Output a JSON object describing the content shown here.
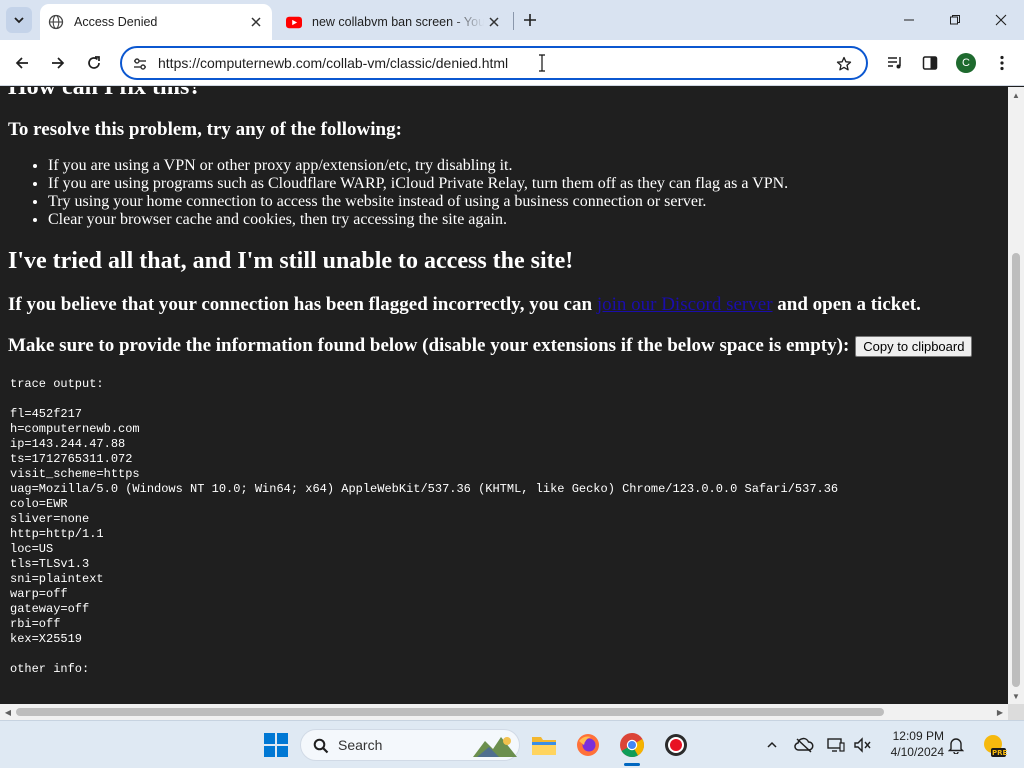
{
  "browser": {
    "tabs": [
      {
        "title": "Access Denied",
        "active": true
      },
      {
        "title": "new collabvm ban screen - You",
        "active": false
      }
    ],
    "url": "https://computernewb.com/collab-vm/classic/denied.html",
    "profile_initial": "C"
  },
  "page": {
    "heading_fix": "How can I fix this?",
    "heading_resolve": "To resolve this problem, try any of the following:",
    "fixes": [
      "If you are using a VPN or other proxy app/extension/etc, try disabling it.",
      "If you are using programs such as Cloudflare WARP, iCloud Private Relay, turn them off as they can flag as a VPN.",
      "Try using your home connection to access the website instead of using a business connection or server.",
      "Clear your browser cache and cookies, then try accessing the site again."
    ],
    "heading_tried": "I've tried all that, and I'm still unable to access the site!",
    "flag_text_before": "If you believe that your connection has been flagged incorrectly, you can",
    "flag_link": "join our Discord server",
    "flag_text_after": "and open a ticket.",
    "make_sure_text": "Make sure to provide the information found below (disable your extensions if the below space is empty):",
    "copy_button": "Copy to clipboard",
    "trace_title": "trace output:",
    "trace_lines": [
      "fl=452f217",
      "h=computernewb.com",
      "ip=143.244.47.88",
      "ts=1712765311.072",
      "visit_scheme=https",
      "uag=Mozilla/5.0 (Windows NT 10.0; Win64; x64) AppleWebKit/537.36 (KHTML, like Gecko) Chrome/123.0.0.0 Safari/537.36",
      "colo=EWR",
      "sliver=none",
      "http=http/1.1",
      "loc=US",
      "tls=TLSv1.3",
      "sni=plaintext",
      "warp=off",
      "gateway=off",
      "rbi=off",
      "kex=X25519"
    ],
    "other_info": "other info:"
  },
  "taskbar": {
    "search_label": "Search",
    "time": "12:09 PM",
    "date": "4/10/2024",
    "weather_badge": "PRE"
  },
  "colors": {
    "page_bg": "#1f1f1f",
    "omnibox_border": "#0b57d0",
    "link": "#1a0dab",
    "taskbar_bg": "#dfe9f3"
  }
}
